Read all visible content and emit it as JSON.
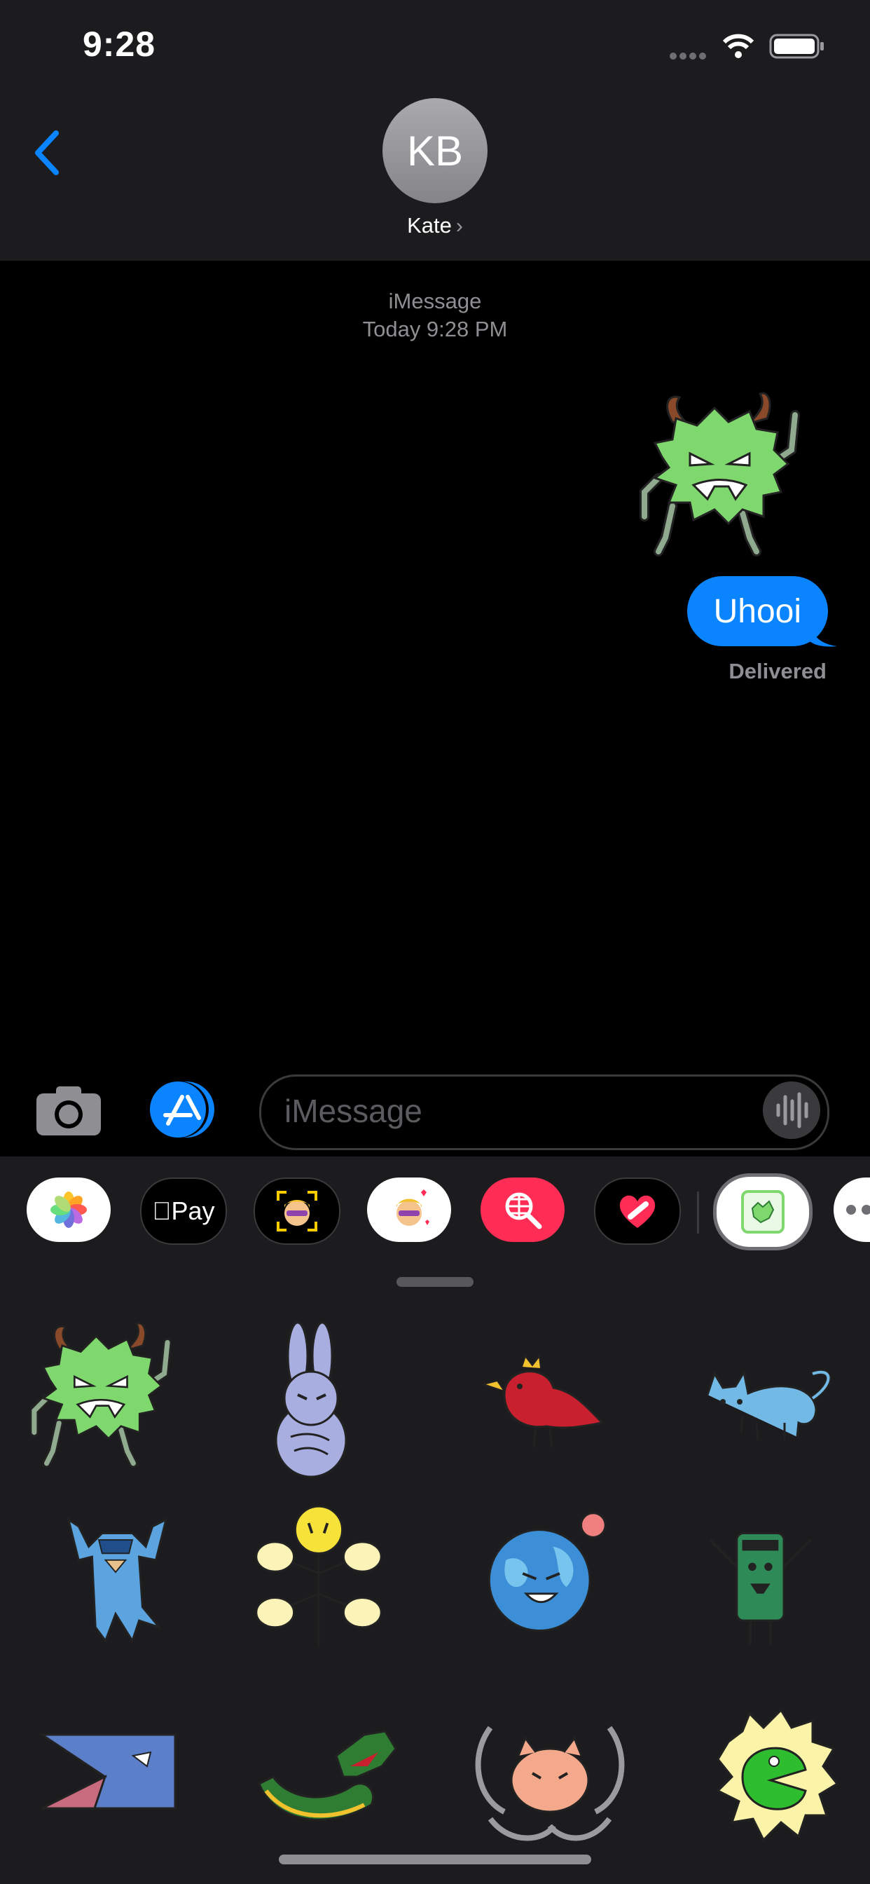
{
  "status_bar": {
    "time": "9:28"
  },
  "header": {
    "avatar_initials": "KB",
    "contact_name": "Kate",
    "chevron": "›"
  },
  "conversation": {
    "service": "iMessage",
    "timestamp": "Today 9:28 PM",
    "messages": [
      {
        "type": "sticker",
        "sticker": "green-monster"
      },
      {
        "type": "text",
        "text": "Uhooi",
        "from": "me"
      }
    ],
    "delivery_status": "Delivered"
  },
  "compose": {
    "placeholder": "iMessage"
  },
  "app_drawer": {
    "apps": [
      {
        "name": "photos",
        "label": ""
      },
      {
        "name": "apple-pay",
        "label": "Pay"
      },
      {
        "name": "memoji",
        "label": ""
      },
      {
        "name": "memoji-stickers",
        "label": ""
      },
      {
        "name": "image-search",
        "label": ""
      },
      {
        "name": "digital-touch",
        "label": ""
      },
      {
        "name": "sticker-pack",
        "label": ""
      },
      {
        "name": "more",
        "label": ""
      }
    ]
  },
  "stickers": [
    "green-monster",
    "purple-rabbit",
    "red-bird",
    "blue-cat",
    "masked-cat",
    "yellow-flower-creature",
    "earth-planet",
    "green-robot",
    "blue-shark",
    "dragon",
    "crab-cat",
    "yellow-green-creature"
  ],
  "colors": {
    "bubble": "#0b84ff",
    "accent": "#0a84ff",
    "background": "#000000",
    "panel": "#1c1c1e"
  }
}
